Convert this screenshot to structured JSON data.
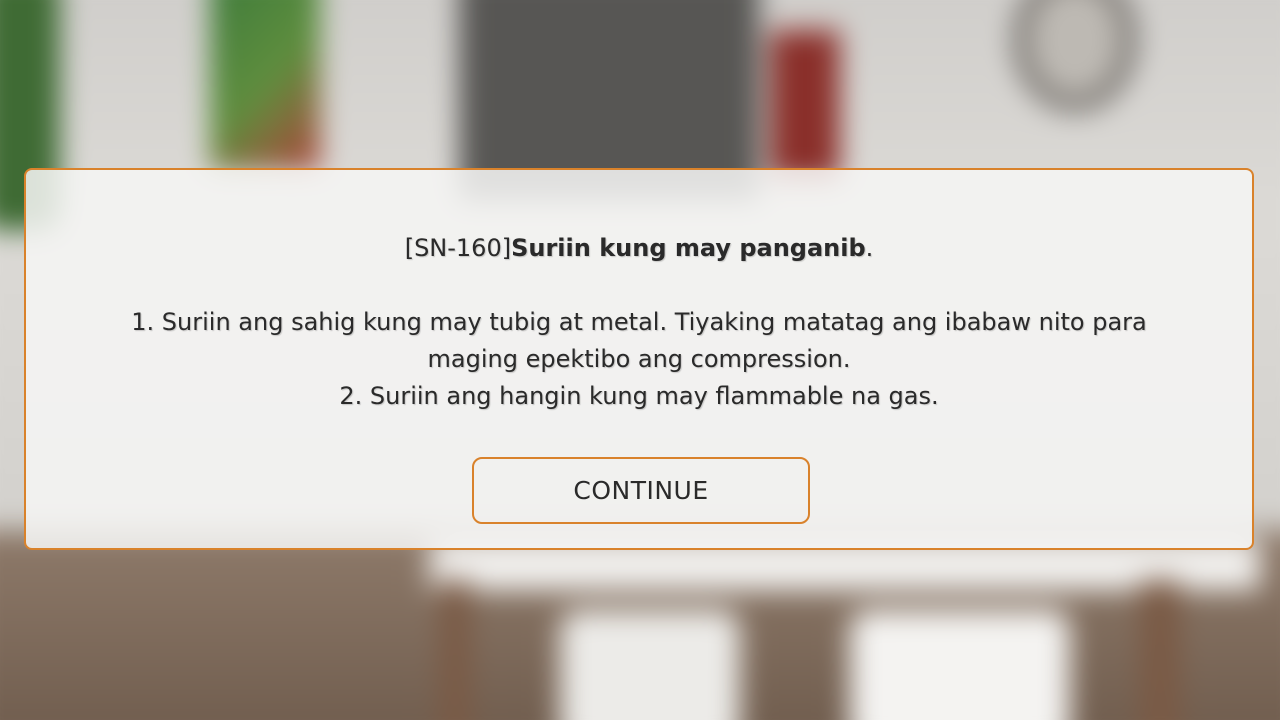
{
  "dialog": {
    "code": "[SN-160]",
    "title": "Suriin kung may panganib",
    "title_suffix": ".",
    "steps": [
      "1. Suriin ang sahig kung may tubig at metal. Tiyaking matatag ang ibabaw nito para maging epektibo ang compression.",
      "2. Suriin ang hangin kung may flammable na gas."
    ],
    "continue_label": "CONTINUE"
  },
  "colors": {
    "accent": "#d9822b",
    "panel_bg": "#f6f6f5",
    "text": "#2a2a2a"
  }
}
